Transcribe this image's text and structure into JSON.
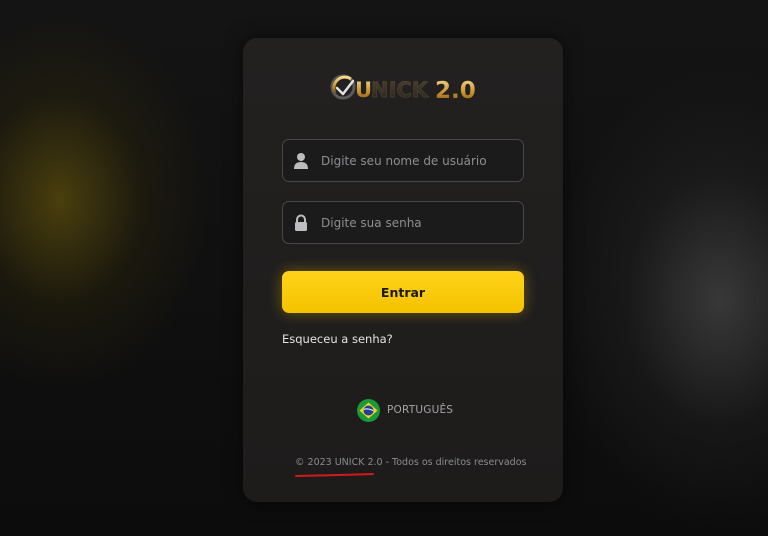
{
  "logo": {
    "text_prefix": "U",
    "text_main": "NICK",
    "text_version": "2.0"
  },
  "login_form": {
    "username": {
      "placeholder": "Digite seu nome de usuário",
      "value": "",
      "icon": "user-icon"
    },
    "password": {
      "placeholder": "Digite sua senha",
      "value": "",
      "icon": "lock-icon"
    },
    "submit_label": "Entrar",
    "forgot_password_label": "Esqueceu a senha?"
  },
  "language": {
    "selected": "PORTUGUÊS",
    "flag": "brazil-flag"
  },
  "footer": {
    "copyright_brand": "© 2023 UNICK 2.0",
    "copyright_rest": " - Todos os direitos reservados"
  },
  "colors": {
    "page_background": "#0f0f0f",
    "card_background": "#211f1e",
    "accent_yellow": "#f7c600",
    "field_border": "#48464a",
    "annotation_red": "#d11a1a"
  }
}
